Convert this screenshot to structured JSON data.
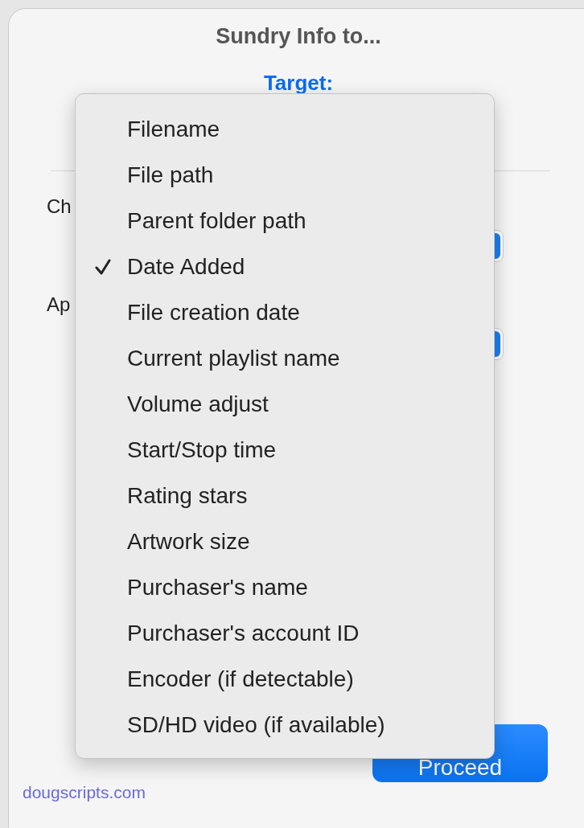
{
  "window": {
    "title": "Sundry Info to..."
  },
  "target_label": "Target:",
  "rows": [
    {
      "label": "Ch"
    },
    {
      "label": "Ap"
    }
  ],
  "menu": {
    "items": [
      {
        "label": "Filename",
        "checked": false
      },
      {
        "label": "File path",
        "checked": false
      },
      {
        "label": "Parent folder path",
        "checked": false
      },
      {
        "label": "Date Added",
        "checked": true
      },
      {
        "label": "File creation date",
        "checked": false
      },
      {
        "label": "Current playlist name",
        "checked": false
      },
      {
        "label": "Volume adjust",
        "checked": false
      },
      {
        "label": "Start/Stop time",
        "checked": false
      },
      {
        "label": "Rating stars",
        "checked": false
      },
      {
        "label": "Artwork size",
        "checked": false
      },
      {
        "label": "Purchaser's name",
        "checked": false
      },
      {
        "label": "Purchaser's account ID",
        "checked": false
      },
      {
        "label": "Encoder (if detectable)",
        "checked": false
      },
      {
        "label": "SD/HD video (if available)",
        "checked": false
      }
    ]
  },
  "proceed_button": "Proceed",
  "footer_link": "dougscripts.com"
}
